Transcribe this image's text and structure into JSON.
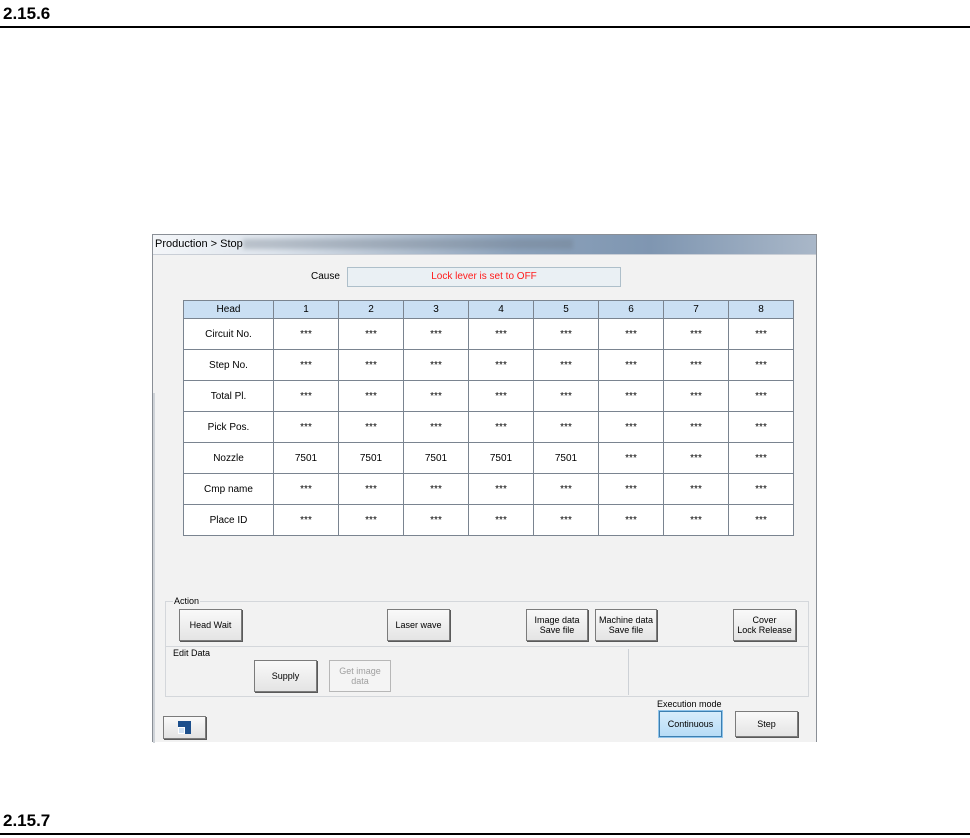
{
  "doc": {
    "heading_top": "2.15.6",
    "heading_bottom": "2.15.7"
  },
  "window": {
    "title": "Production > Stop",
    "cause_label": "Cause",
    "cause_text": "Lock lever is set to OFF",
    "colors": {
      "cause_text": "#ff1a1a",
      "header_bg": "#cadff3",
      "active_button": "#b7dcf6"
    }
  },
  "table": {
    "headers": [
      "Head",
      "1",
      "2",
      "3",
      "4",
      "5",
      "6",
      "7",
      "8"
    ],
    "rows": [
      {
        "label": "Circuit No.",
        "cells": [
          "***",
          "***",
          "***",
          "***",
          "***",
          "***",
          "***",
          "***"
        ]
      },
      {
        "label": "Step No.",
        "cells": [
          "***",
          "***",
          "***",
          "***",
          "***",
          "***",
          "***",
          "***"
        ]
      },
      {
        "label": "Total Pl.",
        "cells": [
          "***",
          "***",
          "***",
          "***",
          "***",
          "***",
          "***",
          "***"
        ]
      },
      {
        "label": "Pick Pos.",
        "cells": [
          "***",
          "***",
          "***",
          "***",
          "***",
          "***",
          "***",
          "***"
        ]
      },
      {
        "label": "Nozzle",
        "cells": [
          "7501",
          "7501",
          "7501",
          "7501",
          "7501",
          "***",
          "***",
          "***"
        ]
      },
      {
        "label": "Cmp name",
        "cells": [
          "***",
          "***",
          "***",
          "***",
          "***",
          "***",
          "***",
          "***"
        ]
      },
      {
        "label": "Place ID",
        "cells": [
          "***",
          "***",
          "***",
          "***",
          "***",
          "***",
          "***",
          "***"
        ]
      }
    ]
  },
  "action": {
    "label": "Action",
    "head_wait": "Head Wait",
    "laser_wave": "Laser wave",
    "image_save": "Image data\nSave file",
    "machine_save": "Machine data\nSave file",
    "cover_release": "Cover\nLock Release"
  },
  "edit": {
    "label": "Edit Data",
    "supply": "Supply",
    "get_image": "Get image data"
  },
  "execution": {
    "label": "Execution mode",
    "continuous": "Continuous",
    "step": "Step"
  },
  "icons": {
    "corner": "window-mode-icon"
  }
}
